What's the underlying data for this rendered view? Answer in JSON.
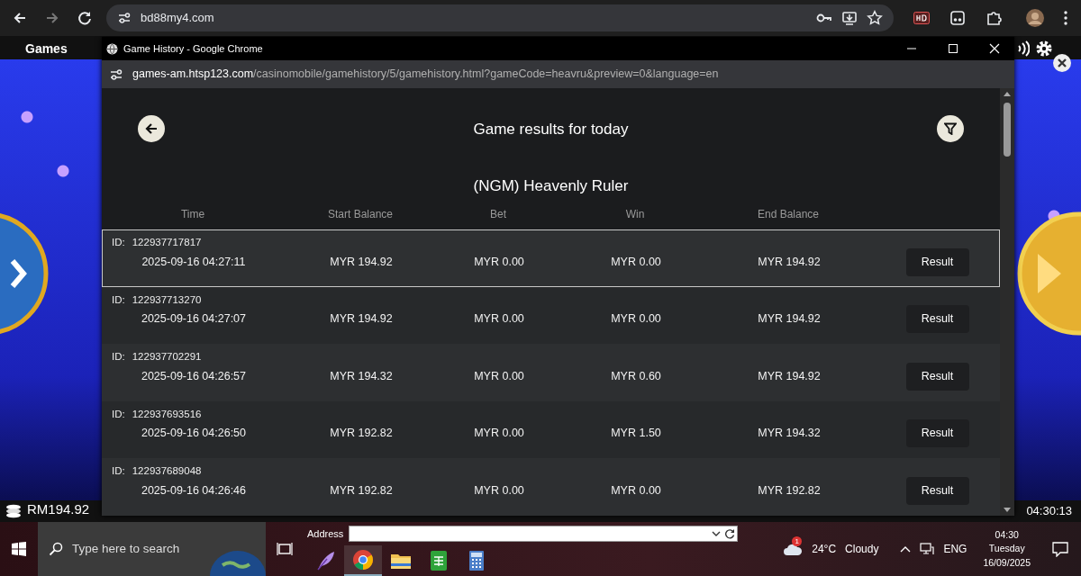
{
  "browser": {
    "url": "bd88my4.com"
  },
  "game": {
    "title": "Games",
    "balance": "RM194.92",
    "clock": "04:30:13"
  },
  "popup": {
    "title": "Game History - Google Chrome",
    "url_host": "games-am.htsp123.com",
    "url_path": "/casinomobile/gamehistory/5/gamehistory.html?gameCode=heavru&preview=0&language=en",
    "heading": "Game results for today",
    "game_name": "(NGM) Heavenly Ruler",
    "columns": [
      "Time",
      "Start Balance",
      "Bet",
      "Win",
      "End Balance"
    ],
    "rows": [
      {
        "id_label": "ID:",
        "id": "122937717817",
        "time": "2025-09-16 04:27:11",
        "start_balance": "MYR 194.92",
        "bet": "MYR 0.00",
        "win": "MYR 0.00",
        "end_balance": "MYR 194.92",
        "action": "Result",
        "selected": true
      },
      {
        "id_label": "ID:",
        "id": "122937713270",
        "time": "2025-09-16 04:27:07",
        "start_balance": "MYR 194.92",
        "bet": "MYR 0.00",
        "win": "MYR 0.00",
        "end_balance": "MYR 194.92",
        "action": "Result",
        "selected": false
      },
      {
        "id_label": "ID:",
        "id": "122937702291",
        "time": "2025-09-16 04:26:57",
        "start_balance": "MYR 194.32",
        "bet": "MYR 0.00",
        "win": "MYR 0.60",
        "end_balance": "MYR 194.92",
        "action": "Result",
        "selected": false
      },
      {
        "id_label": "ID:",
        "id": "122937693516",
        "time": "2025-09-16 04:26:50",
        "start_balance": "MYR 192.82",
        "bet": "MYR 0.00",
        "win": "MYR 1.50",
        "end_balance": "MYR 194.32",
        "action": "Result",
        "selected": false
      },
      {
        "id_label": "ID:",
        "id": "122937689048",
        "time": "2025-09-16 04:26:46",
        "start_balance": "MYR 192.82",
        "bet": "MYR 0.00",
        "win": "MYR 0.00",
        "end_balance": "MYR 192.82",
        "action": "Result",
        "selected": false
      }
    ]
  },
  "taskbar": {
    "search_placeholder": "Type here to search",
    "address_label": "Address",
    "weather_badge": "1",
    "temperature": "24°C",
    "weather": "Cloudy",
    "language": "ENG",
    "time": "04:30",
    "day": "Tuesday",
    "date": "16/09/2025"
  }
}
